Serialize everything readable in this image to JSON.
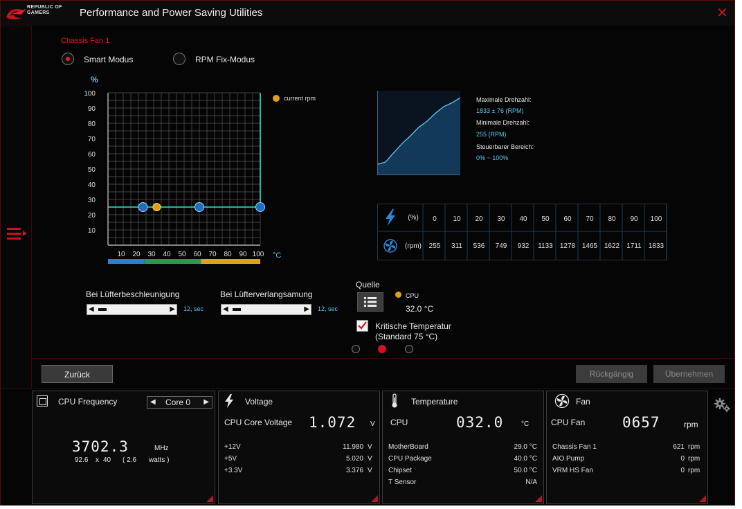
{
  "window": {
    "logo_text": "REPUBLIC OF GAMERS",
    "title": "Performance and Power Saving Utilities"
  },
  "fan": {
    "title": "Chassis Fan 1",
    "modes": [
      {
        "label": "Smart Modus",
        "selected": true
      },
      {
        "label": "RPM Fix-Modus",
        "selected": false
      }
    ],
    "legend": "current rpm",
    "chart_data": {
      "type": "line",
      "title": "",
      "xlabel": "°C",
      "ylabel": "%",
      "x_ticks": [
        10,
        20,
        30,
        40,
        50,
        60,
        70,
        80,
        90,
        100
      ],
      "y_ticks": [
        10,
        20,
        30,
        40,
        50,
        60,
        70,
        80,
        90,
        100
      ],
      "xlim": [
        0,
        100
      ],
      "ylim": [
        0,
        100
      ],
      "grid": true,
      "series": [
        {
          "x": [
            0,
            23,
            60,
            100,
            100
          ],
          "y": [
            25,
            25,
            25,
            25,
            100
          ]
        }
      ],
      "control_points": [
        {
          "x": 23,
          "y": 25
        },
        {
          "x": 60,
          "y": 25
        },
        {
          "x": 100,
          "y": 25
        }
      ],
      "current_point": {
        "x": 32,
        "y": 25
      },
      "zones": [
        {
          "from": 0,
          "to": 24,
          "color": "#2a7fd0"
        },
        {
          "from": 24,
          "to": 61,
          "color": "#2a9a4a"
        },
        {
          "from": 61,
          "to": 100,
          "color": "#e0a01a"
        }
      ],
      "colors": {
        "line": "#39e3c8",
        "point": "#1f6fc0",
        "current": "#e0a010",
        "grid": "#5a5a5a"
      }
    },
    "profile": {
      "max_label": "Maximale Drehzahl:",
      "max_value": "1833 ± 76 (RPM)",
      "min_label": "Minimale Drehzahl:",
      "min_value": "255 (RPM)",
      "range_label": "Steuerbarer Bereich:",
      "range_value": "0% ~ 100%",
      "curve": [
        255,
        311,
        536,
        749,
        932,
        1133,
        1278,
        1465,
        1622,
        1711,
        1833
      ]
    },
    "table": {
      "pct_unit": "(%)",
      "rpm_unit": "(rpm)",
      "pct": [
        "0",
        "10",
        "20",
        "30",
        "40",
        "50",
        "60",
        "70",
        "80",
        "90",
        "100"
      ],
      "rpm": [
        "255",
        "311",
        "536",
        "749",
        "932",
        "1133",
        "1278",
        "1465",
        "1622",
        "1711",
        "1833"
      ]
    },
    "accel": {
      "label": "Bei Lüfterbeschleunigung",
      "value": "12, sec"
    },
    "decel": {
      "label": "Bei Lüfterverlangsamung",
      "value": "12, sec"
    },
    "source": {
      "label": "Quelle",
      "sensor": "CPU",
      "temp": "32.0 °C"
    },
    "critical": {
      "line1": "Kritische Temperatur",
      "line2": "(Standard 75 °C)",
      "checked": true
    },
    "pages": {
      "count": 3,
      "active": 1
    }
  },
  "buttons": {
    "back": "Zurück",
    "undo": "Rückgängig",
    "apply": "Übernehmen"
  },
  "dock": {
    "cpu": {
      "title": "CPU Frequency",
      "core": "Core 0",
      "freq": "3702.3",
      "freq_unit": "MHz",
      "mult_a": "92.6",
      "x": "x",
      "mult_b": "40",
      "watts_open": "( 2.6",
      "watts_unit": "watts )"
    },
    "voltage": {
      "title": "Voltage",
      "core_label": "CPU Core Voltage",
      "core_value": "1.072",
      "core_unit": "V",
      "rows": [
        {
          "label": "+12V",
          "value": "11.980",
          "unit": "V"
        },
        {
          "label": "+5V",
          "value": "5.020",
          "unit": "V"
        },
        {
          "label": "+3.3V",
          "value": "3.376",
          "unit": "V"
        }
      ]
    },
    "temperature": {
      "title": "Temperature",
      "cpu_label": "CPU",
      "cpu_value": "032.0",
      "cpu_unit": "°C",
      "rows": [
        {
          "label": "MotherBoard",
          "value": "29.0 °C"
        },
        {
          "label": "CPU Package",
          "value": "40.0 °C"
        },
        {
          "label": "Chipset",
          "value": "50.0 °C"
        },
        {
          "label": "T Sensor",
          "value": "N/A"
        }
      ]
    },
    "fan": {
      "title": "Fan",
      "cpu_label": "CPU Fan",
      "cpu_value": "0657",
      "cpu_unit": "rpm",
      "rows": [
        {
          "label": "Chassis Fan 1",
          "value": "621",
          "unit": "rpm"
        },
        {
          "label": "AIO Pump",
          "value": "0",
          "unit": "rpm"
        },
        {
          "label": "VRM HS Fan",
          "value": "0",
          "unit": "rpm"
        }
      ]
    }
  }
}
